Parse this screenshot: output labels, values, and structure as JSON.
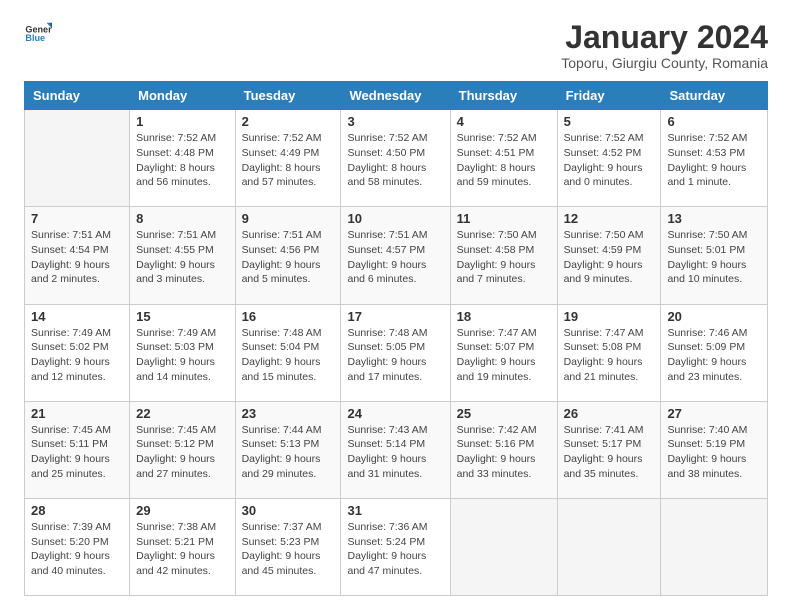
{
  "logo": {
    "general": "General",
    "blue": "Blue"
  },
  "header": {
    "title": "January 2024",
    "subtitle": "Toporu, Giurgiu County, Romania"
  },
  "columns": [
    "Sunday",
    "Monday",
    "Tuesday",
    "Wednesday",
    "Thursday",
    "Friday",
    "Saturday"
  ],
  "weeks": [
    [
      {
        "day": "",
        "info": ""
      },
      {
        "day": "1",
        "info": "Sunrise: 7:52 AM\nSunset: 4:48 PM\nDaylight: 8 hours\nand 56 minutes."
      },
      {
        "day": "2",
        "info": "Sunrise: 7:52 AM\nSunset: 4:49 PM\nDaylight: 8 hours\nand 57 minutes."
      },
      {
        "day": "3",
        "info": "Sunrise: 7:52 AM\nSunset: 4:50 PM\nDaylight: 8 hours\nand 58 minutes."
      },
      {
        "day": "4",
        "info": "Sunrise: 7:52 AM\nSunset: 4:51 PM\nDaylight: 8 hours\nand 59 minutes."
      },
      {
        "day": "5",
        "info": "Sunrise: 7:52 AM\nSunset: 4:52 PM\nDaylight: 9 hours\nand 0 minutes."
      },
      {
        "day": "6",
        "info": "Sunrise: 7:52 AM\nSunset: 4:53 PM\nDaylight: 9 hours\nand 1 minute."
      }
    ],
    [
      {
        "day": "7",
        "info": "Sunrise: 7:51 AM\nSunset: 4:54 PM\nDaylight: 9 hours\nand 2 minutes."
      },
      {
        "day": "8",
        "info": "Sunrise: 7:51 AM\nSunset: 4:55 PM\nDaylight: 9 hours\nand 3 minutes."
      },
      {
        "day": "9",
        "info": "Sunrise: 7:51 AM\nSunset: 4:56 PM\nDaylight: 9 hours\nand 5 minutes."
      },
      {
        "day": "10",
        "info": "Sunrise: 7:51 AM\nSunset: 4:57 PM\nDaylight: 9 hours\nand 6 minutes."
      },
      {
        "day": "11",
        "info": "Sunrise: 7:50 AM\nSunset: 4:58 PM\nDaylight: 9 hours\nand 7 minutes."
      },
      {
        "day": "12",
        "info": "Sunrise: 7:50 AM\nSunset: 4:59 PM\nDaylight: 9 hours\nand 9 minutes."
      },
      {
        "day": "13",
        "info": "Sunrise: 7:50 AM\nSunset: 5:01 PM\nDaylight: 9 hours\nand 10 minutes."
      }
    ],
    [
      {
        "day": "14",
        "info": "Sunrise: 7:49 AM\nSunset: 5:02 PM\nDaylight: 9 hours\nand 12 minutes."
      },
      {
        "day": "15",
        "info": "Sunrise: 7:49 AM\nSunset: 5:03 PM\nDaylight: 9 hours\nand 14 minutes."
      },
      {
        "day": "16",
        "info": "Sunrise: 7:48 AM\nSunset: 5:04 PM\nDaylight: 9 hours\nand 15 minutes."
      },
      {
        "day": "17",
        "info": "Sunrise: 7:48 AM\nSunset: 5:05 PM\nDaylight: 9 hours\nand 17 minutes."
      },
      {
        "day": "18",
        "info": "Sunrise: 7:47 AM\nSunset: 5:07 PM\nDaylight: 9 hours\nand 19 minutes."
      },
      {
        "day": "19",
        "info": "Sunrise: 7:47 AM\nSunset: 5:08 PM\nDaylight: 9 hours\nand 21 minutes."
      },
      {
        "day": "20",
        "info": "Sunrise: 7:46 AM\nSunset: 5:09 PM\nDaylight: 9 hours\nand 23 minutes."
      }
    ],
    [
      {
        "day": "21",
        "info": "Sunrise: 7:45 AM\nSunset: 5:11 PM\nDaylight: 9 hours\nand 25 minutes."
      },
      {
        "day": "22",
        "info": "Sunrise: 7:45 AM\nSunset: 5:12 PM\nDaylight: 9 hours\nand 27 minutes."
      },
      {
        "day": "23",
        "info": "Sunrise: 7:44 AM\nSunset: 5:13 PM\nDaylight: 9 hours\nand 29 minutes."
      },
      {
        "day": "24",
        "info": "Sunrise: 7:43 AM\nSunset: 5:14 PM\nDaylight: 9 hours\nand 31 minutes."
      },
      {
        "day": "25",
        "info": "Sunrise: 7:42 AM\nSunset: 5:16 PM\nDaylight: 9 hours\nand 33 minutes."
      },
      {
        "day": "26",
        "info": "Sunrise: 7:41 AM\nSunset: 5:17 PM\nDaylight: 9 hours\nand 35 minutes."
      },
      {
        "day": "27",
        "info": "Sunrise: 7:40 AM\nSunset: 5:19 PM\nDaylight: 9 hours\nand 38 minutes."
      }
    ],
    [
      {
        "day": "28",
        "info": "Sunrise: 7:39 AM\nSunset: 5:20 PM\nDaylight: 9 hours\nand 40 minutes."
      },
      {
        "day": "29",
        "info": "Sunrise: 7:38 AM\nSunset: 5:21 PM\nDaylight: 9 hours\nand 42 minutes."
      },
      {
        "day": "30",
        "info": "Sunrise: 7:37 AM\nSunset: 5:23 PM\nDaylight: 9 hours\nand 45 minutes."
      },
      {
        "day": "31",
        "info": "Sunrise: 7:36 AM\nSunset: 5:24 PM\nDaylight: 9 hours\nand 47 minutes."
      },
      {
        "day": "",
        "info": ""
      },
      {
        "day": "",
        "info": ""
      },
      {
        "day": "",
        "info": ""
      }
    ]
  ]
}
